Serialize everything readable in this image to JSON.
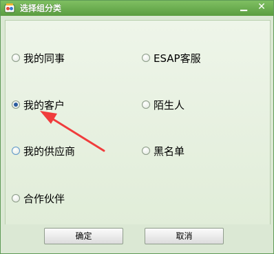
{
  "window": {
    "title": "选择组分类",
    "minimize_glyph": "▁",
    "close_glyph": "✕"
  },
  "options": [
    {
      "label": "我的同事",
      "checked": false
    },
    {
      "label": "ESAP客服",
      "checked": false
    },
    {
      "label": "我的客户",
      "checked": true
    },
    {
      "label": "陌生人",
      "checked": false
    },
    {
      "label": "我的供应商",
      "checked": false
    },
    {
      "label": "黑名单",
      "checked": false
    },
    {
      "label": "合作伙伴",
      "checked": false
    }
  ],
  "buttons": {
    "ok_label": "确定",
    "cancel_label": "取消"
  },
  "colors": {
    "titlebar": "#5a9d40",
    "dialog_bg": "#dbe8d4",
    "annotation_arrow": "#f03c3c"
  },
  "icons": {
    "app": "app-logo-icon",
    "annotation": "red-arrow-annotation"
  }
}
